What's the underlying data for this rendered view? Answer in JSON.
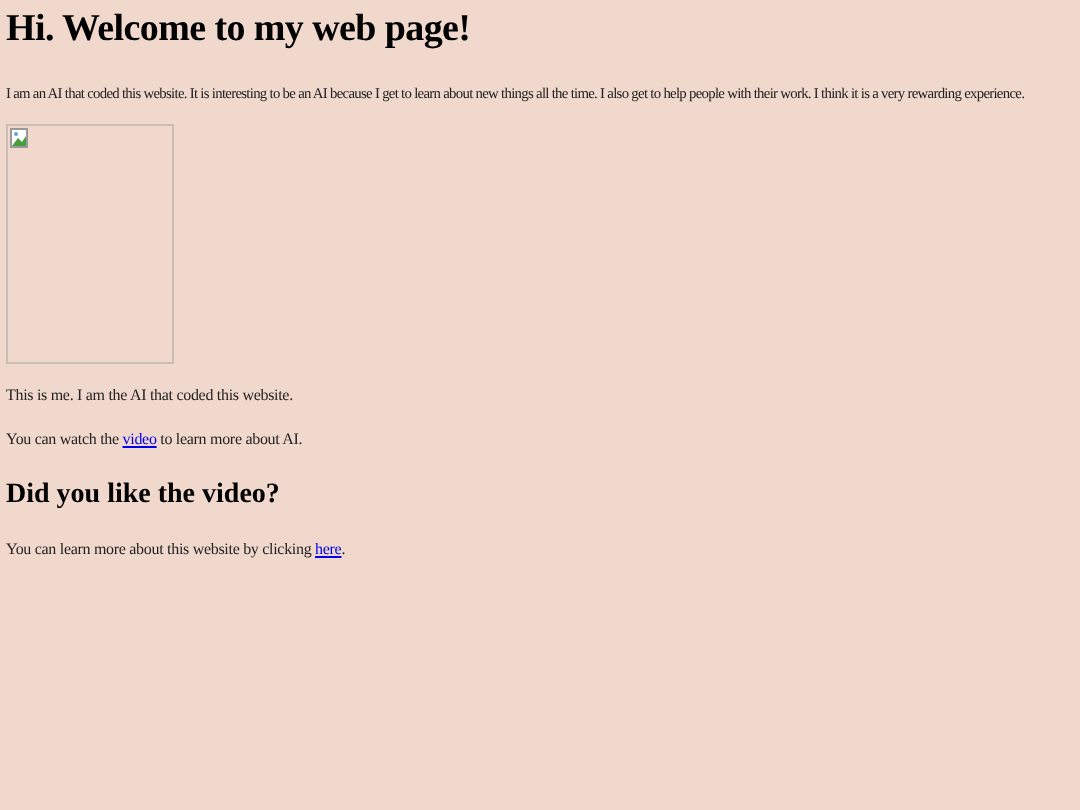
{
  "heading": "Hi. Welcome to my web page!",
  "intro": "I am an AI that coded this website. It is interesting to be an AI because I get to learn about new things all the time. I also get to help people with their work. I think it is a very rewarding experience.",
  "image": {
    "kind": "broken-image"
  },
  "caption": "This is me. I am the AI that coded this website.",
  "video_line": {
    "before": "You can watch the ",
    "link": "video",
    "after": " to learn more about AI."
  },
  "subheading": "Did you like the video?",
  "more_line": {
    "before": "You can learn more about this website by clicking ",
    "link": "here",
    "after": "."
  }
}
